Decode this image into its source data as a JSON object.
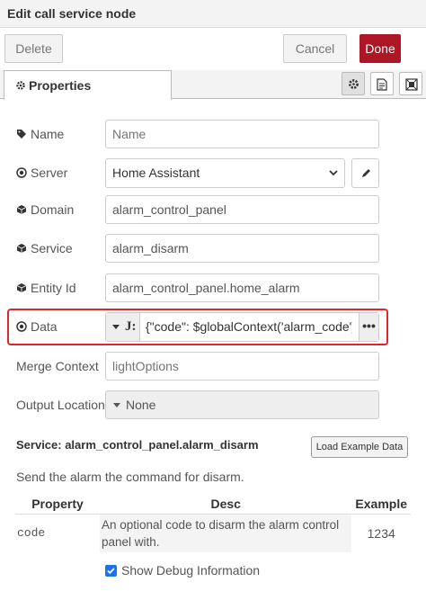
{
  "dialog": {
    "title": "Edit call service node"
  },
  "toolbar": {
    "delete_label": "Delete",
    "cancel_label": "Cancel",
    "done_label": "Done"
  },
  "tabs": {
    "properties_label": "Properties"
  },
  "fields": {
    "name": {
      "label": "Name",
      "placeholder": "Name",
      "value": ""
    },
    "server": {
      "label": "Server",
      "value": "Home Assistant"
    },
    "domain": {
      "label": "Domain",
      "value": "alarm_control_panel"
    },
    "service": {
      "label": "Service",
      "value": "alarm_disarm"
    },
    "entity": {
      "label": "Entity Id",
      "value": "alarm_control_panel.home_alarm"
    },
    "data": {
      "label": "Data",
      "type_symbol": "J:",
      "value": "{\"code\": $globalContext('alarm_code')}",
      "more": "•••"
    },
    "merge": {
      "label": "Merge Context",
      "placeholder": "lightOptions",
      "value": ""
    },
    "output": {
      "label": "Output Location",
      "value": "None"
    }
  },
  "service_info": {
    "title": "Service: alarm_control_panel.alarm_disarm",
    "load_button": "Load Example Data",
    "description": "Send the alarm the command for disarm.",
    "columns": [
      "Property",
      "Desc",
      "Example"
    ],
    "rows": [
      {
        "property": "code",
        "desc": "An optional code to disarm the alarm control panel with.",
        "example": "1234"
      }
    ]
  },
  "debug": {
    "label": "Show Debug Information",
    "checked": true
  },
  "colors": {
    "done_bg": "#ad1625",
    "highlight": "#e0252b",
    "checkbox": "#1a73e8"
  }
}
